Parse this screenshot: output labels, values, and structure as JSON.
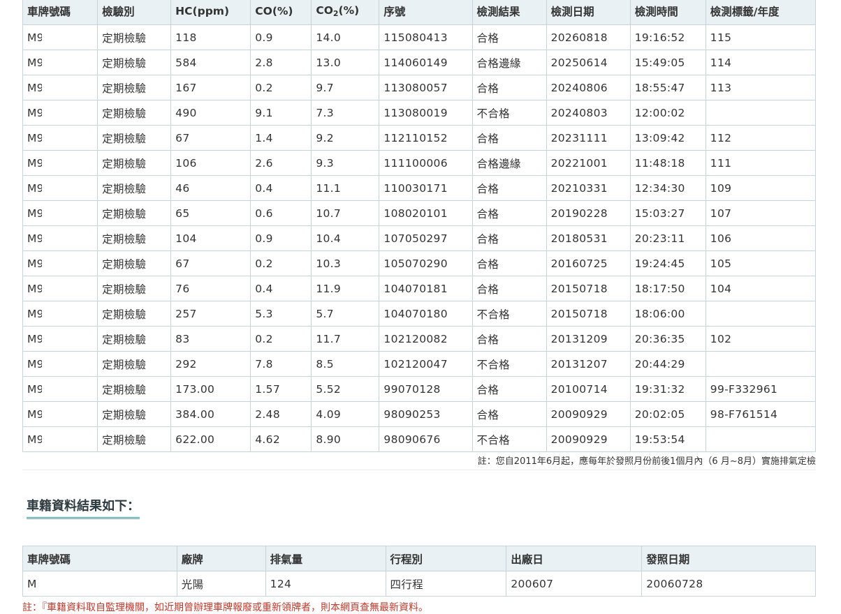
{
  "inspection": {
    "headers": {
      "plate": "車牌號碼",
      "type": "檢驗別",
      "hc": "HC(ppm)",
      "co": "CO(%)",
      "co2_main": "CO",
      "co2_sub": "2",
      "co2_unit": "(%)",
      "serial": "序號",
      "result": "檢測結果",
      "date": "檢測日期",
      "time": "檢測時間",
      "label": "檢測標籤/年度"
    },
    "rows": [
      {
        "plate": "M9",
        "type": "定期檢驗",
        "hc": "118",
        "co": "0.9",
        "co2": "14.0",
        "serial": "115080413",
        "result": "合格",
        "date": "20260818",
        "time": "19:16:52",
        "label": "115"
      },
      {
        "plate": "M9",
        "type": "定期檢驗",
        "hc": "584",
        "co": "2.8",
        "co2": "13.0",
        "serial": "114060149",
        "result": "合格邊緣",
        "date": "20250614",
        "time": "15:49:05",
        "label": "114"
      },
      {
        "plate": "M9",
        "type": "定期檢驗",
        "hc": "167",
        "co": "0.2",
        "co2": "9.7",
        "serial": "113080057",
        "result": "合格",
        "date": "20240806",
        "time": "18:55:47",
        "label": "113"
      },
      {
        "plate": "M9",
        "type": "定期檢驗",
        "hc": "490",
        "co": "9.1",
        "co2": "7.3",
        "serial": "113080019",
        "result": "不合格",
        "date": "20240803",
        "time": "12:00:02",
        "label": ""
      },
      {
        "plate": "M9",
        "type": "定期檢驗",
        "hc": "67",
        "co": "1.4",
        "co2": "9.2",
        "serial": "112110152",
        "result": "合格",
        "date": "20231111",
        "time": "13:09:42",
        "label": "112"
      },
      {
        "plate": "M9",
        "type": "定期檢驗",
        "hc": "106",
        "co": "2.6",
        "co2": "9.3",
        "serial": "111100006",
        "result": "合格邊緣",
        "date": "20221001",
        "time": "11:48:18",
        "label": "111"
      },
      {
        "plate": "M9",
        "type": "定期檢驗",
        "hc": "46",
        "co": "0.4",
        "co2": "11.1",
        "serial": "110030171",
        "result": "合格",
        "date": "20210331",
        "time": "12:34:30",
        "label": "109"
      },
      {
        "plate": "M9",
        "type": "定期檢驗",
        "hc": "65",
        "co": "0.6",
        "co2": "10.7",
        "serial": "108020101",
        "result": "合格",
        "date": "20190228",
        "time": "15:03:27",
        "label": "107"
      },
      {
        "plate": "M9",
        "type": "定期檢驗",
        "hc": "104",
        "co": "0.9",
        "co2": "10.4",
        "serial": "107050297",
        "result": "合格",
        "date": "20180531",
        "time": "20:23:11",
        "label": "106"
      },
      {
        "plate": "M9",
        "type": "定期檢驗",
        "hc": "67",
        "co": "0.2",
        "co2": "10.3",
        "serial": "105070290",
        "result": "合格",
        "date": "20160725",
        "time": "19:24:45",
        "label": "105"
      },
      {
        "plate": "M9",
        "type": "定期檢驗",
        "hc": "76",
        "co": "0.4",
        "co2": "11.9",
        "serial": "104070181",
        "result": "合格",
        "date": "20150718",
        "time": "18:17:50",
        "label": "104"
      },
      {
        "plate": "M9",
        "type": "定期檢驗",
        "hc": "257",
        "co": "5.3",
        "co2": "5.7",
        "serial": "104070180",
        "result": "不合格",
        "date": "20150718",
        "time": "18:06:00",
        "label": ""
      },
      {
        "plate": "M9",
        "type": "定期檢驗",
        "hc": "83",
        "co": "0.2",
        "co2": "11.7",
        "serial": "102120082",
        "result": "合格",
        "date": "20131209",
        "time": "20:36:35",
        "label": "102"
      },
      {
        "plate": "M9",
        "type": "定期檢驗",
        "hc": "292",
        "co": "7.8",
        "co2": "8.5",
        "serial": "102120047",
        "result": "不合格",
        "date": "20131207",
        "time": "20:44:29",
        "label": ""
      },
      {
        "plate": "M9",
        "type": "定期檢驗",
        "hc": "173.00",
        "co": "1.57",
        "co2": "5.52",
        "serial": "99070128",
        "result": "合格",
        "date": "20100714",
        "time": "19:31:32",
        "label": "99-F332961"
      },
      {
        "plate": "M9",
        "type": "定期檢驗",
        "hc": "384.00",
        "co": "2.48",
        "co2": "4.09",
        "serial": "98090253",
        "result": "合格",
        "date": "20090929",
        "time": "20:02:05",
        "label": "98-F761514"
      },
      {
        "plate": "M9",
        "type": "定期檢驗",
        "hc": "622.00",
        "co": "4.62",
        "co2": "8.90",
        "serial": "98090676",
        "result": "不合格",
        "date": "20090929",
        "time": "19:53:54",
        "label": ""
      }
    ],
    "note": "註：您自2011年6月起，應每年於發照月份前後1個月內（6 月~8月）實施排氣定檢"
  },
  "registration": {
    "title": "車籍資料結果如下：",
    "headers": {
      "plate": "車牌號碼",
      "brand": "廠牌",
      "displacement": "排氣量",
      "stroke": "行程別",
      "manufacture": "出廠日",
      "issue": "發照日期"
    },
    "row": {
      "plate": "M",
      "brand": "光陽",
      "displacement": "124",
      "stroke": "四行程",
      "manufacture": "200607",
      "issue": "20060728"
    },
    "note": "註：『車籍資料取自監理機關，如近期曾辦理車牌報廢或重新領牌者，則本網頁查無最新資料。"
  },
  "colors": {
    "header_bg": "#eaf1f4",
    "border": "#c6d3da",
    "accent": "#3aa0a8",
    "note_red": "#c0392b"
  }
}
